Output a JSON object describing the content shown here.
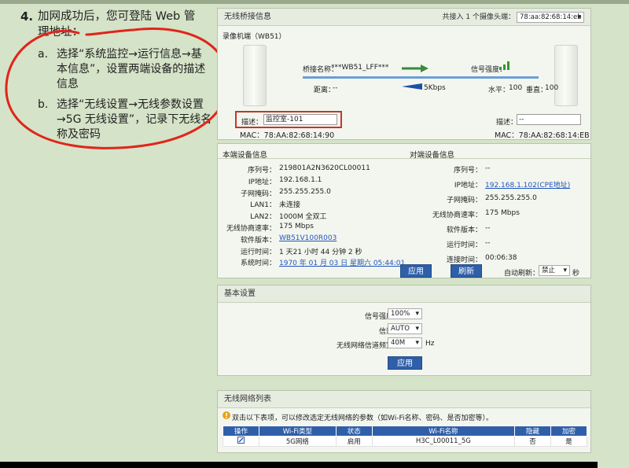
{
  "instructions": {
    "number": "4.",
    "intro": "加网成功后，您可登陆 Web 管理地址：",
    "a_letter": "a.",
    "a_text": "选择“系统监控→运行信息→基本信息”，设置两端设备的描述信息",
    "b_letter": "b.",
    "b_text": "选择“无线设置→无线参数设置→5G 无线设置”，记录下无线名称及密码"
  },
  "bridge": {
    "header": "无线桥接信息",
    "connected_text": "共接入 1 个摄像头端：",
    "connected_select": "78:aa:82:68:14:eb",
    "device_title": "录像机端（WB51）",
    "bridge_name_label": "桥接名称：",
    "bridge_name": "***WB51_LFF***",
    "signal_label": "信号强度：",
    "distance_label": "距离：",
    "distance": "--",
    "rate": "5Kbps",
    "horizontal_label": "水平：",
    "horizontal": "100",
    "vertical_label": "垂直：",
    "vertical": "100",
    "left_desc_label": "描述：",
    "left_desc": "监控室-101",
    "left_mac": "MAC：78:AA:82:68:14:90",
    "right_desc_label": "描述：",
    "right_desc": "--",
    "right_mac": "MAC：78:AA:82:68:14:EB"
  },
  "local": {
    "header": "本端设备信息",
    "rows": [
      {
        "label": "序列号：",
        "value": "219801A2N3620CL00011"
      },
      {
        "label": "IP地址：",
        "value": "192.168.1.1"
      },
      {
        "label": "子网掩码：",
        "value": "255.255.255.0"
      },
      {
        "label": "LAN1：",
        "value": "未连接"
      },
      {
        "label": "LAN2：",
        "value": "1000M 全双工"
      },
      {
        "label": "无线协商速率：",
        "value": "175 Mbps"
      },
      {
        "label": "软件版本：",
        "value": "WB51V100R003"
      },
      {
        "label": "运行时间：",
        "value": "1 天21 小时 44 分钟 2 秒"
      },
      {
        "label": "系统时间：",
        "value": "1970 年 01 月 03 日 星期六 05:44:01"
      }
    ]
  },
  "remote": {
    "header": "对端设备信息",
    "rows": [
      {
        "label": "序列号：",
        "value": "--"
      },
      {
        "label": "IP地址：",
        "value": "192.168.1.102(CPE地址)"
      },
      {
        "label": "子网掩码：",
        "value": "255.255.255.0"
      },
      {
        "label": "无线协商速率：",
        "value": "175 Mbps"
      },
      {
        "label": "软件版本：",
        "value": "--"
      },
      {
        "label": "运行时间：",
        "value": "--"
      },
      {
        "label": "连接时间：",
        "value": "00:06:38"
      }
    ],
    "apply": "应用",
    "refresh": "刷新",
    "auto_refresh_label": "自动刷新：",
    "auto_refresh_value": "禁止",
    "seconds": "秒"
  },
  "basic": {
    "header": "基本设置",
    "signal_label": "信号强度：",
    "signal_value": "100%",
    "channel_label": "信道：",
    "channel_value": "AUTO",
    "bandwidth_label": "无线网络信道频宽：",
    "bandwidth_value": "40M",
    "bandwidth_unit": "Hz",
    "apply": "应用"
  },
  "wlan": {
    "header": "无线网络列表",
    "tip": "双击以下表项，可以修改选定无线网络的参数（如Wi-Fi名称、密码、是否加密等）。",
    "columns": [
      "操作",
      "Wi-Fi类型",
      "状态",
      "Wi-Fi名称",
      "隐藏",
      "加密"
    ],
    "row": [
      "",
      "5G网络",
      "启用",
      "H3C_L00011_5G",
      "否",
      "是"
    ]
  }
}
